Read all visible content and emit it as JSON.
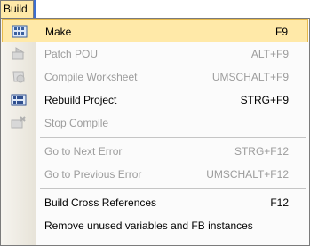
{
  "menubar": {
    "build_label": "Build"
  },
  "menu": {
    "items": [
      {
        "label": "Make",
        "shortcut": "F9",
        "icon": "make-icon"
      },
      {
        "label": "Patch POU",
        "shortcut": "ALT+F9",
        "icon": "patch-icon"
      },
      {
        "label": "Compile Worksheet",
        "shortcut": "UMSCHALT+F9",
        "icon": "compile-icon"
      },
      {
        "label": "Rebuild Project",
        "shortcut": "STRG+F9",
        "icon": "rebuild-icon"
      },
      {
        "label": "Stop Compile",
        "shortcut": "",
        "icon": "stop-icon"
      },
      {
        "label": "Go to Next Error",
        "shortcut": "STRG+F12"
      },
      {
        "label": "Go to Previous Error",
        "shortcut": "UMSCHALT+F12"
      },
      {
        "label": "Build Cross References",
        "shortcut": "F12"
      },
      {
        "label": "Remove unused variables and FB instances",
        "shortcut": ""
      }
    ]
  },
  "colors": {
    "highlight": "#ffe9a8",
    "highlight_border": "#e6b94c",
    "disabled_text": "#9c9c9c"
  }
}
